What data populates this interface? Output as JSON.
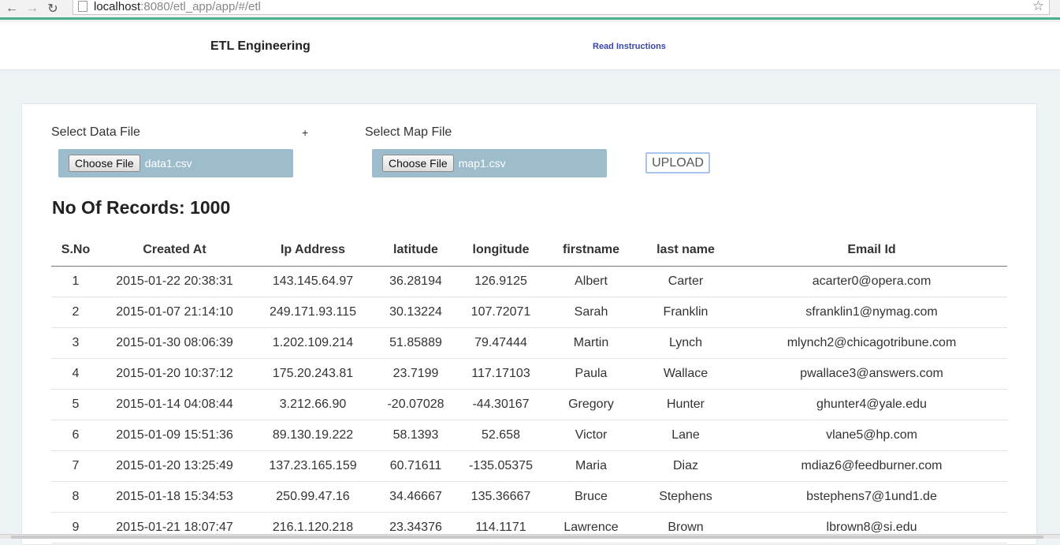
{
  "browser": {
    "url_host": "localhost",
    "url_path": ":8080/etl_app/app/#/etl",
    "back_icon": "back-arrow-icon",
    "forward_icon": "forward-arrow-icon",
    "reload_icon": "reload-icon",
    "star_icon": "star-icon"
  },
  "header": {
    "brand": "ETL Engineering",
    "read_instructions": "Read Instructions"
  },
  "upload": {
    "data_label": "Select Data File",
    "plus": "+",
    "map_label": "Select Map File",
    "choose_file": "Choose File",
    "data_file_name": "data1.csv",
    "map_file_name": "map1.csv",
    "upload_label": "UPLOAD"
  },
  "records": {
    "label": "No Of Records: 1000"
  },
  "table": {
    "headers": [
      "S.No",
      "Created At",
      "Ip Address",
      "latitude",
      "longitude",
      "firstname",
      "last name",
      "Email Id"
    ],
    "rows": [
      [
        "1",
        "2015-01-22 20:38:31",
        "143.145.64.97",
        "36.28194",
        "126.9125",
        "Albert",
        "Carter",
        "acarter0@opera.com"
      ],
      [
        "2",
        "2015-01-07 21:14:10",
        "249.171.93.115",
        "30.13224",
        "107.72071",
        "Sarah",
        "Franklin",
        "sfranklin1@nymag.com"
      ],
      [
        "3",
        "2015-01-30 08:06:39",
        "1.202.109.214",
        "51.85889",
        "79.47444",
        "Martin",
        "Lynch",
        "mlynch2@chicagotribune.com"
      ],
      [
        "4",
        "2015-01-20 10:37:12",
        "175.20.243.81",
        "23.7199",
        "117.17103",
        "Paula",
        "Wallace",
        "pwallace3@answers.com"
      ],
      [
        "5",
        "2015-01-14 04:08:44",
        "3.212.66.90",
        "-20.07028",
        "-44.30167",
        "Gregory",
        "Hunter",
        "ghunter4@yale.edu"
      ],
      [
        "6",
        "2015-01-09 15:51:36",
        "89.130.19.222",
        "58.1393",
        "52.658",
        "Victor",
        "Lane",
        "vlane5@hp.com"
      ],
      [
        "7",
        "2015-01-20 13:25:49",
        "137.23.165.159",
        "60.71611",
        "-135.05375",
        "Maria",
        "Diaz",
        "mdiaz6@feedburner.com"
      ],
      [
        "8",
        "2015-01-18 15:34:53",
        "250.99.47.16",
        "34.46667",
        "135.36667",
        "Bruce",
        "Stephens",
        "bstephens7@1und1.de"
      ],
      [
        "9",
        "2015-01-21 18:07:47",
        "216.1.120.218",
        "23.34376",
        "114.1171",
        "Lawrence",
        "Brown",
        "lbrown8@si.edu"
      ]
    ]
  }
}
